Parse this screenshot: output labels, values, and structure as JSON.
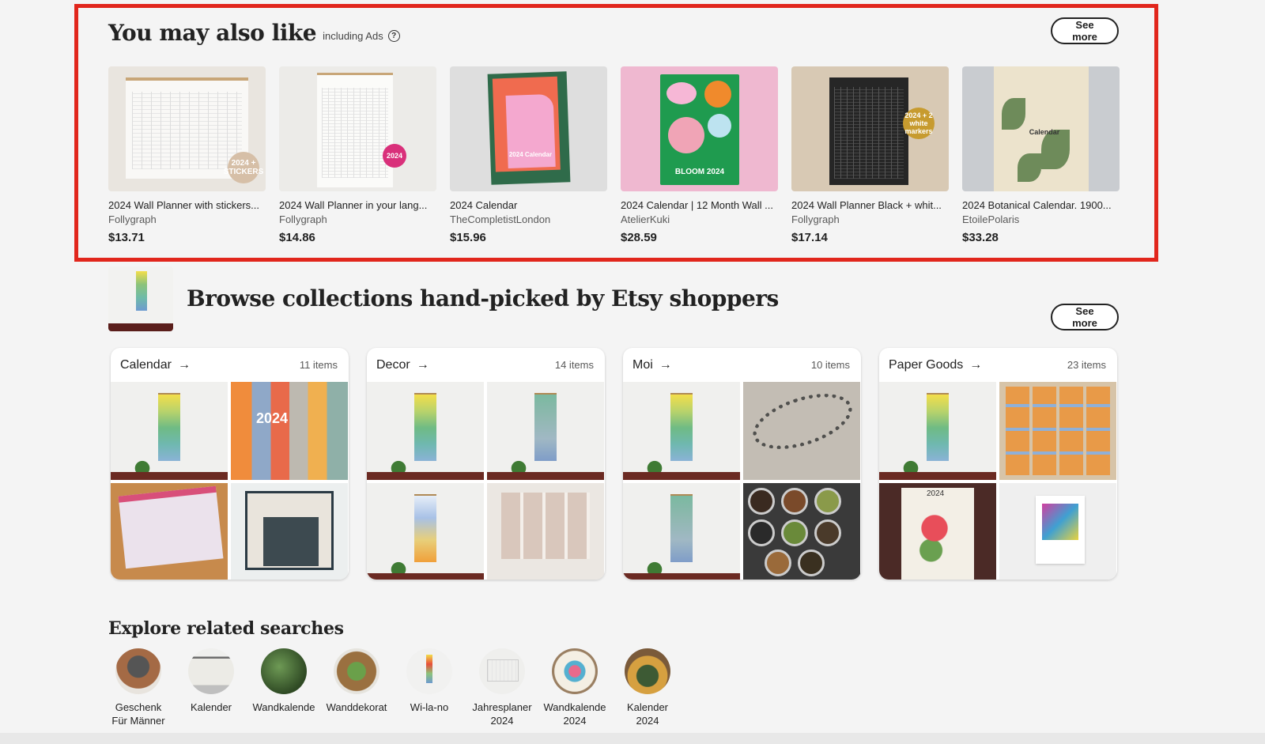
{
  "recommendations": {
    "title": "You may also like",
    "subtitle": "including Ads",
    "help_glyph": "?",
    "see_more_label": "See more",
    "products": [
      {
        "title": "2024 Wall Planner with stickers...",
        "shop": "Follygraph",
        "price": "$13.71",
        "badge": "2024 + STICKERS"
      },
      {
        "title": "2024 Wall Planner in your lang...",
        "shop": "Follygraph",
        "price": "$14.86",
        "badge": "2024"
      },
      {
        "title": "2024 Calendar",
        "shop": "TheCompletistLondon",
        "price": "$15.96",
        "badge": "2024 Calendar"
      },
      {
        "title": "2024 Calendar | 12 Month Wall ...",
        "shop": "AtelierKuki",
        "price": "$28.59",
        "badge": "BLOOM  2024"
      },
      {
        "title": "2024 Wall Planner Black + whit...",
        "shop": "Follygraph",
        "price": "$17.14",
        "badge": "2024 + 2 white markers"
      },
      {
        "title": "2024 Botanical Calendar. 1900...",
        "shop": "EtoilePolaris",
        "price": "$33.28",
        "badge": "Calendar"
      }
    ]
  },
  "collections_section": {
    "title": "Browse collections hand-picked by Etsy shoppers",
    "see_more_label": "See more",
    "arrow_glyph": "→",
    "collections": [
      {
        "name": "Calendar",
        "count": "11 items",
        "tile_text": "2024"
      },
      {
        "name": "Decor",
        "count": "14 items"
      },
      {
        "name": "Moi",
        "count": "10 items"
      },
      {
        "name": "Paper Goods",
        "count": "23 items",
        "tile_text": "2024"
      }
    ]
  },
  "related_searches": {
    "title": "Explore related searches",
    "items": [
      {
        "line1": "Geschenk",
        "line2": "Für Männer"
      },
      {
        "line1": "Kalender",
        "line2": ""
      },
      {
        "line1": "Wandkalende",
        "line2": ""
      },
      {
        "line1": "Wanddekorat",
        "line2": ""
      },
      {
        "line1": "Wi-la-no",
        "line2": ""
      },
      {
        "line1": "Jahresplaner",
        "line2": "2024"
      },
      {
        "line1": "Wandkalende",
        "line2": "2024"
      },
      {
        "line1": "Kalender",
        "line2": "2024"
      }
    ]
  },
  "colors": {
    "highlight": "#e1261c",
    "background": "#f4f4f4",
    "text": "#222222",
    "muted": "#595959"
  }
}
